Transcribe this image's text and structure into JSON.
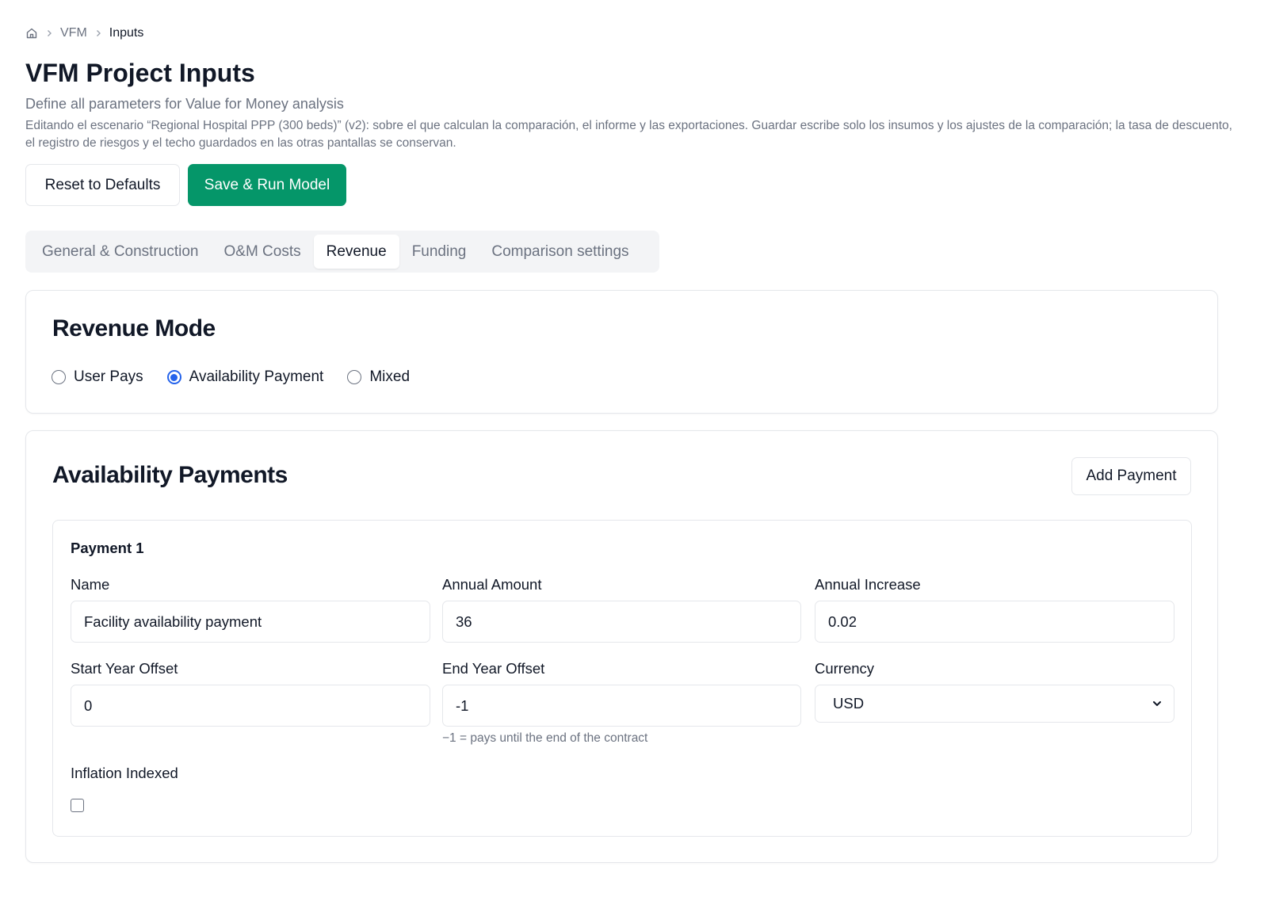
{
  "breadcrumb": {
    "home_icon": "home-icon",
    "items": [
      "VFM",
      "Inputs"
    ]
  },
  "page": {
    "title": "VFM Project Inputs",
    "subtitle": "Define all parameters for Value for Money analysis",
    "note": "Editando el escenario “Regional Hospital PPP (300 beds)” (v2): sobre el que calculan la comparación, el informe y las exportaciones. Guardar escribe solo los insumos y los ajustes de la comparación; la tasa de descuento, el registro de riesgos y el techo guardados en las otras pantallas se conservan."
  },
  "actions": {
    "reset_label": "Reset to Defaults",
    "save_label": "Save & Run Model"
  },
  "tabs": [
    {
      "label": "General & Construction",
      "active": false
    },
    {
      "label": "O&M Costs",
      "active": false
    },
    {
      "label": "Revenue",
      "active": true
    },
    {
      "label": "Funding",
      "active": false
    },
    {
      "label": "Comparison settings",
      "active": false
    }
  ],
  "revenue_mode": {
    "title": "Revenue Mode",
    "options": [
      {
        "label": "User Pays",
        "checked": false
      },
      {
        "label": "Availability Payment",
        "checked": true
      },
      {
        "label": "Mixed",
        "checked": false
      }
    ]
  },
  "availability": {
    "title": "Availability Payments",
    "add_label": "Add Payment",
    "payment": {
      "title": "Payment 1",
      "name_label": "Name",
      "name_value": "Facility availability payment",
      "amount_label": "Annual Amount",
      "amount_value": "36",
      "increase_label": "Annual Increase",
      "increase_value": "0.02",
      "start_label": "Start Year Offset",
      "start_value": "0",
      "end_label": "End Year Offset",
      "end_value": "-1",
      "end_hint": "−1 = pays until the end of the contract",
      "currency_label": "Currency",
      "currency_value": "USD",
      "inflation_label": "Inflation Indexed",
      "inflation_checked": false
    }
  },
  "colors": {
    "primary": "#059669",
    "radio_accent": "#2563eb",
    "muted_text": "#6b7280",
    "border": "#e5e7eb"
  }
}
